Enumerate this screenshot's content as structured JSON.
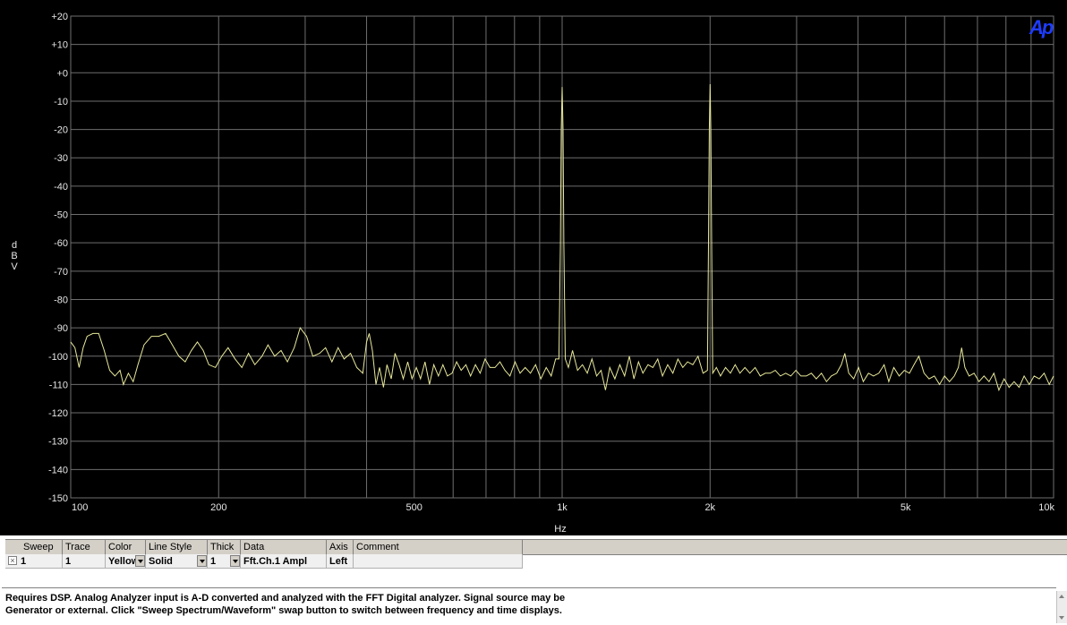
{
  "chart_data": {
    "type": "line",
    "xlabel": "Hz",
    "ylabel": "dBV",
    "x_scale": "log",
    "xlim": [
      100,
      10000
    ],
    "ylim": [
      -150,
      20
    ],
    "x_ticks": [
      {
        "value": 100,
        "label": "100"
      },
      {
        "value": 200,
        "label": "200"
      },
      {
        "value": 500,
        "label": "500"
      },
      {
        "value": 1000,
        "label": "1k"
      },
      {
        "value": 2000,
        "label": "2k"
      },
      {
        "value": 5000,
        "label": "5k"
      },
      {
        "value": 10000,
        "label": "10k"
      }
    ],
    "y_ticks": [
      {
        "value": 20,
        "label": "+20"
      },
      {
        "value": 10,
        "label": "+10"
      },
      {
        "value": 0,
        "label": "+0"
      },
      {
        "value": -10,
        "label": "-10"
      },
      {
        "value": -20,
        "label": "-20"
      },
      {
        "value": -30,
        "label": "-30"
      },
      {
        "value": -40,
        "label": "-40"
      },
      {
        "value": -50,
        "label": "-50"
      },
      {
        "value": -60,
        "label": "-60"
      },
      {
        "value": -70,
        "label": "-70"
      },
      {
        "value": -80,
        "label": "-80"
      },
      {
        "value": -90,
        "label": "-90"
      },
      {
        "value": -100,
        "label": "-100"
      },
      {
        "value": -110,
        "label": "-110"
      },
      {
        "value": -120,
        "label": "-120"
      },
      {
        "value": -130,
        "label": "-130"
      },
      {
        "value": -140,
        "label": "-140"
      },
      {
        "value": -150,
        "label": "-150"
      }
    ],
    "grid": true,
    "series": [
      {
        "color": "#e8e89a",
        "points": [
          [
            100,
            -95
          ],
          [
            102,
            -97
          ],
          [
            104,
            -104
          ],
          [
            106,
            -97
          ],
          [
            108,
            -93
          ],
          [
            111,
            -92
          ],
          [
            114,
            -92
          ],
          [
            117,
            -98
          ],
          [
            120,
            -105
          ],
          [
            123,
            -107
          ],
          [
            126,
            -105
          ],
          [
            128,
            -110
          ],
          [
            131,
            -106
          ],
          [
            134,
            -109
          ],
          [
            137,
            -103
          ],
          [
            141,
            -96
          ],
          [
            146,
            -93
          ],
          [
            151,
            -93
          ],
          [
            156,
            -92
          ],
          [
            161,
            -96
          ],
          [
            166,
            -100
          ],
          [
            171,
            -102
          ],
          [
            176,
            -98
          ],
          [
            181,
            -95
          ],
          [
            186,
            -98
          ],
          [
            191,
            -103
          ],
          [
            197,
            -104
          ],
          [
            203,
            -100
          ],
          [
            209,
            -97
          ],
          [
            216,
            -101
          ],
          [
            223,
            -104
          ],
          [
            230,
            -99
          ],
          [
            237,
            -103
          ],
          [
            245,
            -100
          ],
          [
            252,
            -96
          ],
          [
            260,
            -100
          ],
          [
            268,
            -98
          ],
          [
            276,
            -102
          ],
          [
            285,
            -97
          ],
          [
            293,
            -90
          ],
          [
            302,
            -93
          ],
          [
            311,
            -100
          ],
          [
            321,
            -99
          ],
          [
            330,
            -97
          ],
          [
            340,
            -102
          ],
          [
            350,
            -97
          ],
          [
            360,
            -101
          ],
          [
            371,
            -99
          ],
          [
            382,
            -104
          ],
          [
            393,
            -106
          ],
          [
            400,
            -95
          ],
          [
            405,
            -92
          ],
          [
            411,
            -98
          ],
          [
            418,
            -110
          ],
          [
            425,
            -104
          ],
          [
            433,
            -111
          ],
          [
            440,
            -103
          ],
          [
            449,
            -108
          ],
          [
            457,
            -99
          ],
          [
            466,
            -103
          ],
          [
            475,
            -108
          ],
          [
            485,
            -102
          ],
          [
            495,
            -108
          ],
          [
            505,
            -104
          ],
          [
            515,
            -108
          ],
          [
            526,
            -102
          ],
          [
            537,
            -110
          ],
          [
            548,
            -103
          ],
          [
            560,
            -107
          ],
          [
            572,
            -103
          ],
          [
            584,
            -107
          ],
          [
            597,
            -106
          ],
          [
            610,
            -102
          ],
          [
            623,
            -105
          ],
          [
            637,
            -103
          ],
          [
            651,
            -107
          ],
          [
            666,
            -103
          ],
          [
            681,
            -106
          ],
          [
            697,
            -101
          ],
          [
            713,
            -104
          ],
          [
            730,
            -104
          ],
          [
            747,
            -102
          ],
          [
            765,
            -105
          ],
          [
            783,
            -107
          ],
          [
            802,
            -102
          ],
          [
            821,
            -106
          ],
          [
            841,
            -104
          ],
          [
            862,
            -106
          ],
          [
            883,
            -103
          ],
          [
            905,
            -108
          ],
          [
            928,
            -104
          ],
          [
            950,
            -107
          ],
          [
            970,
            -101
          ],
          [
            985,
            -101
          ],
          [
            992,
            -60
          ],
          [
            996,
            -20
          ],
          [
            1000,
            -5
          ],
          [
            1004,
            -20
          ],
          [
            1008,
            -60
          ],
          [
            1015,
            -101
          ],
          [
            1030,
            -104
          ],
          [
            1050,
            -98
          ],
          [
            1075,
            -105
          ],
          [
            1100,
            -103
          ],
          [
            1125,
            -106
          ],
          [
            1150,
            -101
          ],
          [
            1175,
            -107
          ],
          [
            1200,
            -105
          ],
          [
            1225,
            -112
          ],
          [
            1250,
            -104
          ],
          [
            1280,
            -108
          ],
          [
            1310,
            -103
          ],
          [
            1340,
            -107
          ],
          [
            1370,
            -100
          ],
          [
            1400,
            -108
          ],
          [
            1430,
            -102
          ],
          [
            1460,
            -106
          ],
          [
            1495,
            -103
          ],
          [
            1530,
            -104
          ],
          [
            1565,
            -101
          ],
          [
            1600,
            -107
          ],
          [
            1640,
            -103
          ],
          [
            1680,
            -106
          ],
          [
            1720,
            -101
          ],
          [
            1760,
            -104
          ],
          [
            1800,
            -102
          ],
          [
            1845,
            -103
          ],
          [
            1890,
            -100
          ],
          [
            1935,
            -106
          ],
          [
            1975,
            -105
          ],
          [
            1985,
            -60
          ],
          [
            1993,
            -20
          ],
          [
            2000,
            -4
          ],
          [
            2007,
            -20
          ],
          [
            2015,
            -60
          ],
          [
            2025,
            -106
          ],
          [
            2060,
            -104
          ],
          [
            2100,
            -107
          ],
          [
            2150,
            -104
          ],
          [
            2200,
            -106
          ],
          [
            2250,
            -103
          ],
          [
            2300,
            -106
          ],
          [
            2355,
            -104
          ],
          [
            2410,
            -106
          ],
          [
            2470,
            -104
          ],
          [
            2530,
            -107
          ],
          [
            2590,
            -106
          ],
          [
            2650,
            -106
          ],
          [
            2715,
            -105
          ],
          [
            2780,
            -107
          ],
          [
            2850,
            -106
          ],
          [
            2920,
            -107
          ],
          [
            2990,
            -105
          ],
          [
            3060,
            -107
          ],
          [
            3140,
            -107
          ],
          [
            3215,
            -106
          ],
          [
            3290,
            -108
          ],
          [
            3370,
            -106
          ],
          [
            3450,
            -109
          ],
          [
            3530,
            -107
          ],
          [
            3620,
            -106
          ],
          [
            3700,
            -103
          ],
          [
            3760,
            -99
          ],
          [
            3830,
            -106
          ],
          [
            3920,
            -108
          ],
          [
            4010,
            -104
          ],
          [
            4100,
            -109
          ],
          [
            4200,
            -106
          ],
          [
            4300,
            -107
          ],
          [
            4410,
            -106
          ],
          [
            4520,
            -103
          ],
          [
            4620,
            -109
          ],
          [
            4730,
            -104
          ],
          [
            4850,
            -107
          ],
          [
            4970,
            -105
          ],
          [
            5090,
            -106
          ],
          [
            5200,
            -103
          ],
          [
            5320,
            -100
          ],
          [
            5450,
            -106
          ],
          [
            5580,
            -108
          ],
          [
            5720,
            -107
          ],
          [
            5860,
            -110
          ],
          [
            6000,
            -107
          ],
          [
            6140,
            -109
          ],
          [
            6280,
            -107
          ],
          [
            6400,
            -104
          ],
          [
            6500,
            -97
          ],
          [
            6600,
            -104
          ],
          [
            6730,
            -107
          ],
          [
            6890,
            -106
          ],
          [
            7050,
            -109
          ],
          [
            7220,
            -107
          ],
          [
            7390,
            -109
          ],
          [
            7560,
            -106
          ],
          [
            7740,
            -112
          ],
          [
            7930,
            -108
          ],
          [
            8120,
            -111
          ],
          [
            8310,
            -109
          ],
          [
            8510,
            -111
          ],
          [
            8710,
            -107
          ],
          [
            8920,
            -110
          ],
          [
            9130,
            -107
          ],
          [
            9350,
            -108
          ],
          [
            9570,
            -106
          ],
          [
            9800,
            -110
          ],
          [
            10000,
            -107
          ]
        ]
      }
    ]
  },
  "logo": "Ap",
  "grid": {
    "columns": [
      "Sweep",
      "Trace",
      "Color",
      "Line Style",
      "Thick",
      "Data",
      "Axis",
      "Comment"
    ],
    "row": {
      "sweep": "1",
      "trace": "1",
      "color": "Yellow",
      "line_style": "Solid",
      "thick": "1",
      "data": "Fft.Ch.1 Ampl",
      "axis": "Left",
      "comment": ""
    }
  },
  "description": {
    "line1": "Requires DSP.  Analog Analyzer input is A-D converted and analyzed with the FFT Digital analyzer.  Signal source may be",
    "line2": "Generator or external.  Click \"Sweep Spectrum/Waveform\" swap button to switch between frequency and time displays."
  }
}
